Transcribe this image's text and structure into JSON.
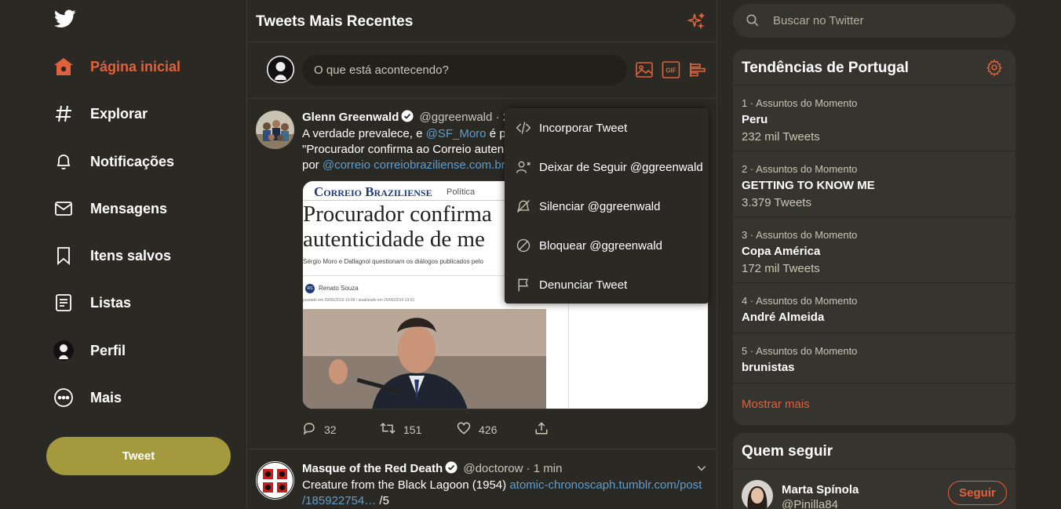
{
  "colors": {
    "accent": "#e0613d",
    "link": "#5d9ecf",
    "tweet_button": "#a49a3d",
    "background": "#2b2924",
    "panel": "#36342e"
  },
  "nav": {
    "logo": "twitter-bird-icon",
    "items": [
      {
        "label": "Página inicial",
        "icon": "home-icon",
        "active": true
      },
      {
        "label": "Explorar",
        "icon": "hashtag-icon"
      },
      {
        "label": "Notificações",
        "icon": "bell-icon"
      },
      {
        "label": "Mensagens",
        "icon": "envelope-icon"
      },
      {
        "label": "Itens salvos",
        "icon": "bookmark-icon"
      },
      {
        "label": "Listas",
        "icon": "list-icon"
      },
      {
        "label": "Perfil",
        "icon": "profile-avatar-icon"
      },
      {
        "label": "Mais",
        "icon": "more-circle-icon"
      }
    ],
    "tweet_button": "Tweet"
  },
  "main": {
    "title": "Tweets Mais Recentes",
    "composer_placeholder": "O que está acontecendo?",
    "gif_label": "GIF"
  },
  "tweets": [
    {
      "name": "Glenn Greenwald",
      "handle": "@ggreenwald",
      "time": "· 2 m",
      "line1_a": "A verdade prevalece, e ",
      "line1_link": "@SF_Moro",
      "line1_b": " é pe",
      "line2": "\"Procurador confirma ao Correio auten",
      "line3_a": "por ",
      "line3_link1": "@correio",
      "line3_link2": "correiobraziliense.com.br",
      "media": {
        "masthead": "Correio Braziliense",
        "section": "Política",
        "headline1": "Procurador confirma",
        "headline2": "autenticidade de me",
        "standfirst": "Sérgio Moro e Dallagnol questionam os diálogos publicados pelo",
        "author_initials": "RS",
        "author": "Renato Souza",
        "dateline": "postado em 29/06/2019 19:06 / atualizado em 29/06/2019 19:53"
      },
      "reply_count": "32",
      "retweet_count": "151",
      "like_count": "426"
    },
    {
      "name": "Masque of the Red Death",
      "handle": "@doctorow",
      "time": "· 1 min",
      "line1_a": "Creature from the Black Lagoon (1954) ",
      "line1_link": "atomic-chronoscaph.tumblr.com/post",
      "line2_link": "/185922754…",
      "line2_b": " /5"
    }
  ],
  "menu": {
    "items": [
      {
        "label": "Incorporar Tweet",
        "icon": "code-icon"
      },
      {
        "label": "Deixar de Seguir @ggreenwald",
        "icon": "unfollow-icon"
      },
      {
        "label": "Silenciar @ggreenwald",
        "icon": "mute-icon"
      },
      {
        "label": "Bloquear @ggreenwald",
        "icon": "block-icon"
      },
      {
        "label": "Denunciar Tweet",
        "icon": "flag-icon"
      }
    ]
  },
  "search": {
    "placeholder": "Buscar no Twitter"
  },
  "trends": {
    "title": "Tendências de Portugal",
    "items": [
      {
        "meta": "1 · Assuntos do Momento",
        "name": "Peru",
        "count": "232 mil Tweets"
      },
      {
        "meta": "2 · Assuntos do Momento",
        "name": "GETTING TO KNOW ME",
        "count": "3.379 Tweets"
      },
      {
        "meta": "3 · Assuntos do Momento",
        "name": "Copa América",
        "count": "172 mil Tweets"
      },
      {
        "meta": "4 · Assuntos do Momento",
        "name": "André Almeida",
        "count": ""
      },
      {
        "meta": "5 · Assuntos do Momento",
        "name": "brunistas",
        "count": ""
      }
    ],
    "show_more": "Mostrar mais"
  },
  "who_to_follow": {
    "title": "Quem seguir",
    "name": "Marta Spínola",
    "handle": "@Pinilla84",
    "follow_label": "Seguir"
  }
}
